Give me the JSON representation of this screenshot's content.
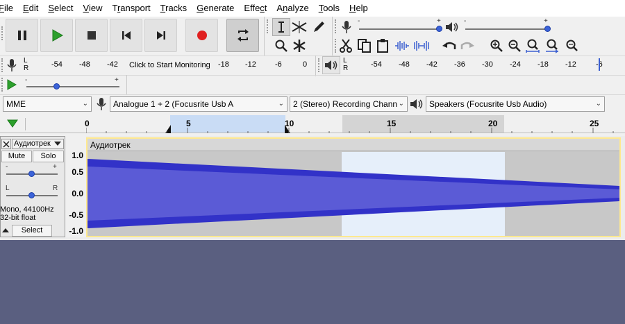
{
  "menu": [
    "File",
    "Edit",
    "Select",
    "View",
    "Transport",
    "Tracks",
    "Generate",
    "Effect",
    "Analyze",
    "Tools",
    "Help"
  ],
  "menu_underline": [
    "F",
    "E",
    "S",
    "V",
    "r",
    "T",
    "G",
    "c",
    "n",
    "T",
    "H"
  ],
  "recording_meter": {
    "ticks": [
      "-54",
      "-48",
      "-42",
      "-18",
      "-12",
      "-6",
      "0"
    ],
    "prompt": "Click to Start Monitoring",
    "l": "L",
    "r": "R"
  },
  "playback_meter": {
    "ticks": [
      "-54",
      "-48",
      "-42",
      "-36",
      "-30",
      "-24",
      "-18",
      "-12",
      "-6"
    ],
    "l": "L",
    "r": "R"
  },
  "sliders": {
    "minus": "-",
    "plus": "+"
  },
  "device": {
    "host": "MME",
    "input": "Analogue 1 + 2 (Focusrite Usb A",
    "channels": "2 (Stereo) Recording Chann",
    "output": "Speakers (Focusrite Usb Audio)"
  },
  "timeline": {
    "labels": [
      "0",
      "5",
      "10",
      "15",
      "20",
      "25"
    ]
  },
  "track": {
    "name": "Аудиотрек",
    "mute": "Mute",
    "solo": "Solo",
    "gain_minus": "-",
    "gain_plus": "+",
    "pan_l": "L",
    "pan_r": "R",
    "format_rate": "Mono, 44100Hz",
    "format_bits": "32-bit float",
    "select": "Select",
    "clip_name": "Аудиотрек",
    "scale": [
      "1.0",
      "0.5",
      "0.0",
      "-0.5",
      "-1.0"
    ]
  },
  "colors": {
    "wave_outer": "#3232c8",
    "wave_inner": "#5b5bd6",
    "background": "#5a5f80",
    "selection": "#e6effa",
    "play_green": "#2ca02c",
    "record_red": "#e02020"
  }
}
